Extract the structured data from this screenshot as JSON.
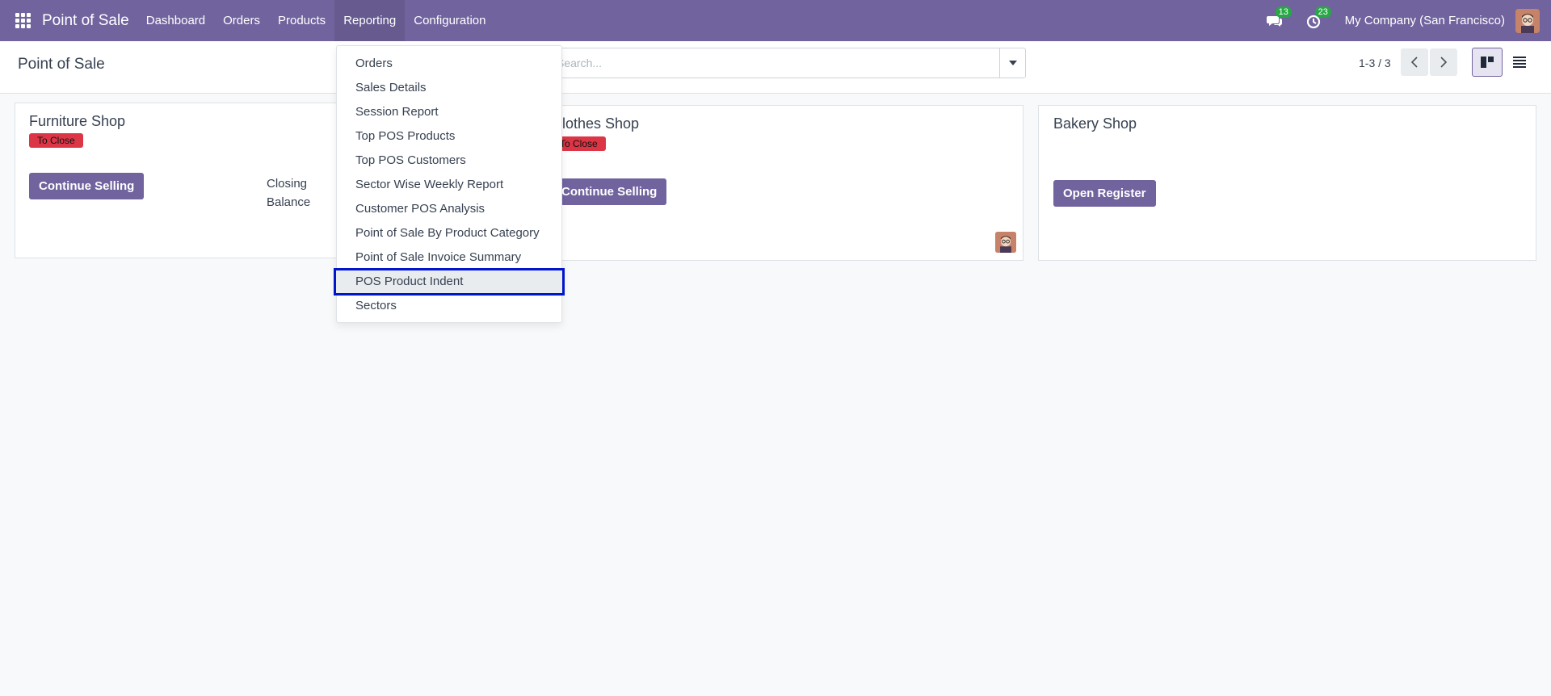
{
  "navbar": {
    "app_name": "Point of Sale",
    "menu": [
      "Dashboard",
      "Orders",
      "Products",
      "Reporting",
      "Configuration"
    ],
    "active_menu": "Reporting",
    "messages_count": "13",
    "activities_count": "23",
    "company": "My Company (San Francisco)",
    "bg_color": "#71639e"
  },
  "control_panel": {
    "title": "Point of Sale",
    "search_placeholder": "Search...",
    "pager": "1-3 / 3",
    "active_view": "kanban"
  },
  "cards": [
    {
      "name": "Furniture Shop",
      "status": "To Close",
      "button": "Continue Selling",
      "closing_label_1": "Closing",
      "closing_label_2": "Balance"
    },
    {
      "name": "Clothes Shop",
      "status": "To Close",
      "button": "Continue Selling"
    },
    {
      "name": "Bakery Shop",
      "button": "Open Register"
    }
  ],
  "reporting_menu": {
    "items": [
      "Orders",
      "Sales Details",
      "Session Report",
      "Top POS Products",
      "Top POS Customers",
      "Sector Wise Weekly Report",
      "Customer POS Analysis",
      "Point of Sale By Product Category",
      "Point of Sale Invoice Summary",
      "POS Product Indent",
      "Sectors"
    ],
    "highlighted_item": "POS Product Indent"
  },
  "colors": {
    "brand": "#71639e",
    "status_red": "#dc3545",
    "highlight_outline": "#0015cc"
  }
}
